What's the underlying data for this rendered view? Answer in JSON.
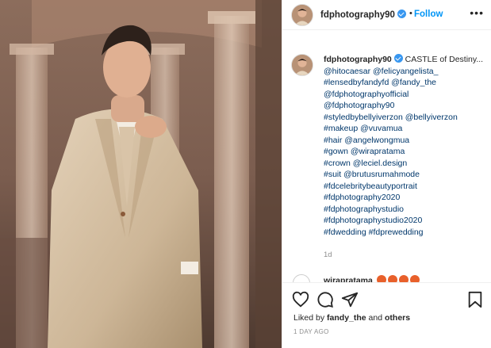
{
  "post": {
    "image_alt": "Man in beige suit posing in front of palace columns"
  },
  "header": {
    "avatar_icon": "profile-avatar",
    "username": "fdphotography90",
    "separator": "•",
    "follow_label": "Follow",
    "more_label": "•••"
  },
  "caption": {
    "username": "fdphotography90",
    "first_line": "CASTLE of Destiny...",
    "lines": [
      "@hitocaesar @felicyangelista_",
      "#lensedbyfandyfd @fandy_the",
      "@fdphotographyofficial",
      "@fdphotography90",
      "#styledbybellyiverzon @bellyiverzon",
      "#makeup @vuvamua",
      "#hair @angelwongmua",
      "#gown @wirapratama",
      "#crown @leciel.design",
      "#suit @brutusrumahmode",
      "#fdcelebritybeautyportrait",
      "#fdphotography2020",
      "#fdphotographystudio",
      "#fdphotographystudio2020",
      "#fdwedding #fdprewedding"
    ],
    "time": "1d"
  },
  "comment": {
    "username": "wirapratama"
  },
  "actions": {
    "like_icon": "heart-icon",
    "comment_icon": "comment-icon",
    "share_icon": "share-icon",
    "save_icon": "bookmark-icon"
  },
  "likes": {
    "prefix": "Liked by",
    "user": "fandy_the",
    "suffix": "and",
    "others": "others"
  },
  "date": "1 DAY AGO",
  "colors": {
    "link": "#00376b",
    "follow": "#0095f6",
    "verified": "#3897f0",
    "muted": "#8e8e8e"
  }
}
